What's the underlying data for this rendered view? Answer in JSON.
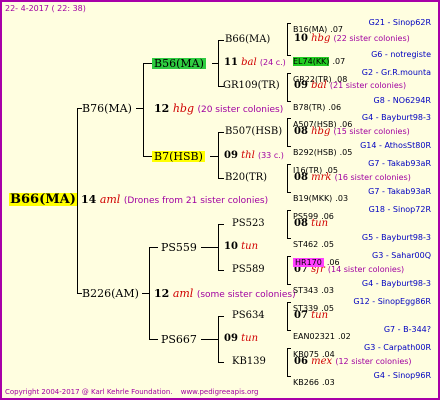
{
  "header": {
    "date": "22-  4-2017 ( 22: 38)"
  },
  "footer": {
    "copyright": "Copyright 2004-2017 @ Karl Kehrle Foundation.",
    "website": "www.pedigreeapis.org"
  },
  "root": {
    "name": "B66(MA)",
    "gen": "14",
    "race": "aml",
    "note": "(Drones from 21 sister colonies)"
  },
  "gen1": [
    {
      "name": "B76(MA)",
      "gen": "12",
      "race": "hbg",
      "note": "(20 sister colonies)"
    },
    {
      "name": "B226(AM)",
      "gen": "12",
      "race": "aml",
      "note": "(some sister colonies)"
    }
  ],
  "gen2": [
    {
      "name": "B56(MA)",
      "gen": "11",
      "race": "bal",
      "note": "(24 c.)"
    },
    {
      "name": "B7(HSB)",
      "gen": "09",
      "race": "thl",
      "note": "(33 c.)"
    },
    {
      "name": "PS559",
      "gen": "10",
      "race": "tun",
      "note": ""
    },
    {
      "name": "PS667",
      "gen": "09",
      "race": "tun",
      "note": ""
    }
  ],
  "gen3": [
    {
      "name": "B66(MA)",
      "gen": "10",
      "race": "hbg",
      "note": "(22 sister colonies)"
    },
    {
      "name": "GR109(TR)",
      "gen": "09",
      "race": "bal",
      "note": "(21 sister colonies)"
    },
    {
      "name": "B507(HSB)",
      "gen": "08",
      "race": "hbg",
      "note": "(15 sister colonies)"
    },
    {
      "name": "B20(TR)",
      "gen": "08",
      "race": "mrk",
      "note": "(16 sister colonies)"
    },
    {
      "name": "PS523",
      "gen": "08",
      "race": "tun",
      "note": ""
    },
    {
      "name": "PS589",
      "gen": "07",
      "race": "sfr",
      "note": "(14 sister colonies)"
    },
    {
      "name": "PS634",
      "gen": "07",
      "race": "tun",
      "note": ""
    },
    {
      "name": "KB139",
      "gen": "06",
      "race": "mex",
      "note": "(12 sister colonies)"
    }
  ],
  "gen4": [
    {
      "name": "B16(MA)",
      "year": ".07",
      "breeder": "G21 - Sinop62R"
    },
    {
      "name": "EL74(KK)",
      "year": ".07",
      "breeder": "G6 - notregiste"
    },
    {
      "name": "GR22(TR)",
      "year": ".08",
      "breeder": "G2 - Gr.R.mounta"
    },
    {
      "name": "B78(TR)",
      "year": ".06",
      "breeder": "G8 - NO6294R"
    },
    {
      "name": "A507(HSB)",
      "year": ".06",
      "breeder": "G4 - Bayburt98-3"
    },
    {
      "name": "B292(HSB)",
      "year": ".05",
      "breeder": "G14 - AthosSt80R"
    },
    {
      "name": "I16(TR)",
      "year": ".05",
      "breeder": "G7 - Takab93aR"
    },
    {
      "name": "B19(MKK)",
      "year": ".03",
      "breeder": "G7 - Takab93aR"
    },
    {
      "name": "PS599",
      "year": ".06",
      "breeder": "G18 - Sinop72R"
    },
    {
      "name": "ST462",
      "year": ".05",
      "breeder": "G5 - Bayburt98-3"
    },
    {
      "name": "HR170",
      "year": ".06",
      "breeder": "G3 - Sahar00Q"
    },
    {
      "name": "ST343",
      "year": ".03",
      "breeder": "G4 - Bayburt98-3"
    },
    {
      "name": "ST339",
      "year": ".05",
      "breeder": "G12 - SinopEgg86R"
    },
    {
      "name": "EAN02321",
      "year": ".02",
      "breeder": "G7 - B-344?"
    },
    {
      "name": "KB075",
      "year": ".04",
      "breeder": "G3 - Carpath00R"
    },
    {
      "name": "KB266",
      "year": ".03",
      "breeder": "G4 - Sinop96R"
    }
  ]
}
